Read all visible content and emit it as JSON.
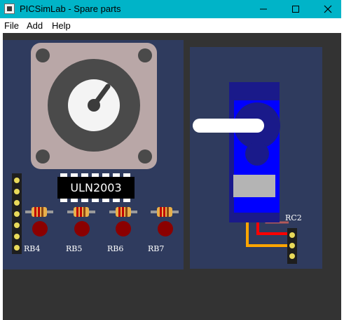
{
  "window": {
    "title": "PICSimLab - Spare parts",
    "accent": "#00b4c8",
    "controls": [
      "minimize-icon",
      "maximize-icon",
      "close-icon"
    ]
  },
  "menu": {
    "file": "File",
    "add": "Add",
    "help": "Help"
  },
  "parts": {
    "driver_label": "ULN2003",
    "leds": [
      "RB4",
      "RB5",
      "RB6",
      "RB7"
    ],
    "servo_pin": "RC2"
  },
  "colors": {
    "workspace": "#333333",
    "panel": "#2f3b5e",
    "led": "#8b0000",
    "servo_body": "#1a1ad9",
    "servo_horn": "#ffffff"
  }
}
